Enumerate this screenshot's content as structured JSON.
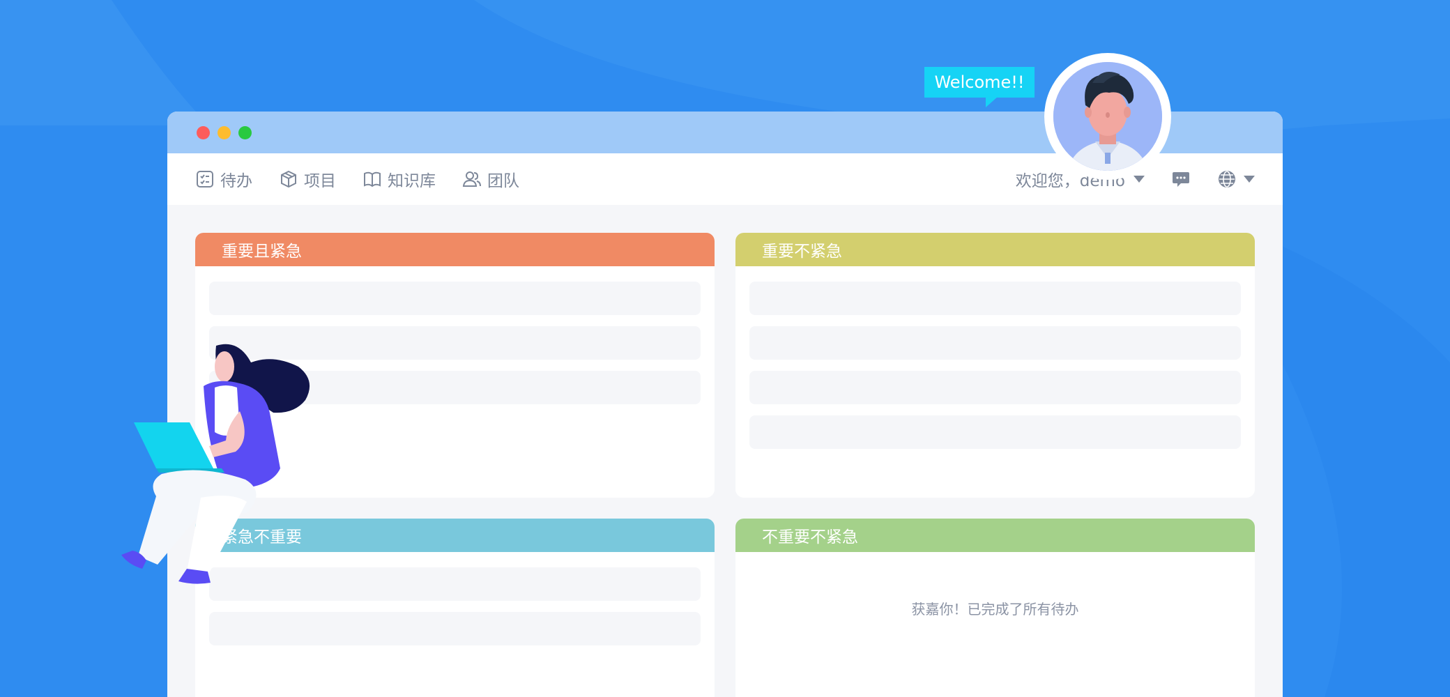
{
  "colors": {
    "background": "#2f8cf0",
    "titlebar": "#9fc9f8",
    "q1_header": "#f08a64",
    "q2_header": "#d3cf6e",
    "q3_header": "#79c8dc",
    "q4_header": "#a4d18a",
    "welcome_bubble": "#16d3f5"
  },
  "welcome_text": "Welcome!!",
  "nav": {
    "items": [
      {
        "label": "待办",
        "icon": "todo-icon"
      },
      {
        "label": "项目",
        "icon": "project-box-icon"
      },
      {
        "label": "知识库",
        "icon": "book-icon"
      },
      {
        "label": "团队",
        "icon": "team-icon"
      }
    ],
    "greeting": "欢迎您，demo",
    "message_icon": "message-icon",
    "language_icon": "globe-icon"
  },
  "quadrants": [
    {
      "title": "重要且紧急",
      "item_count": 3
    },
    {
      "title": "重要不紧急",
      "item_count": 4
    },
    {
      "title": "紧急不重要",
      "item_count": 2
    },
    {
      "title": "不重要不紧急",
      "item_count": 0,
      "empty_message": "获嘉你！已完成了所有待办"
    }
  ]
}
